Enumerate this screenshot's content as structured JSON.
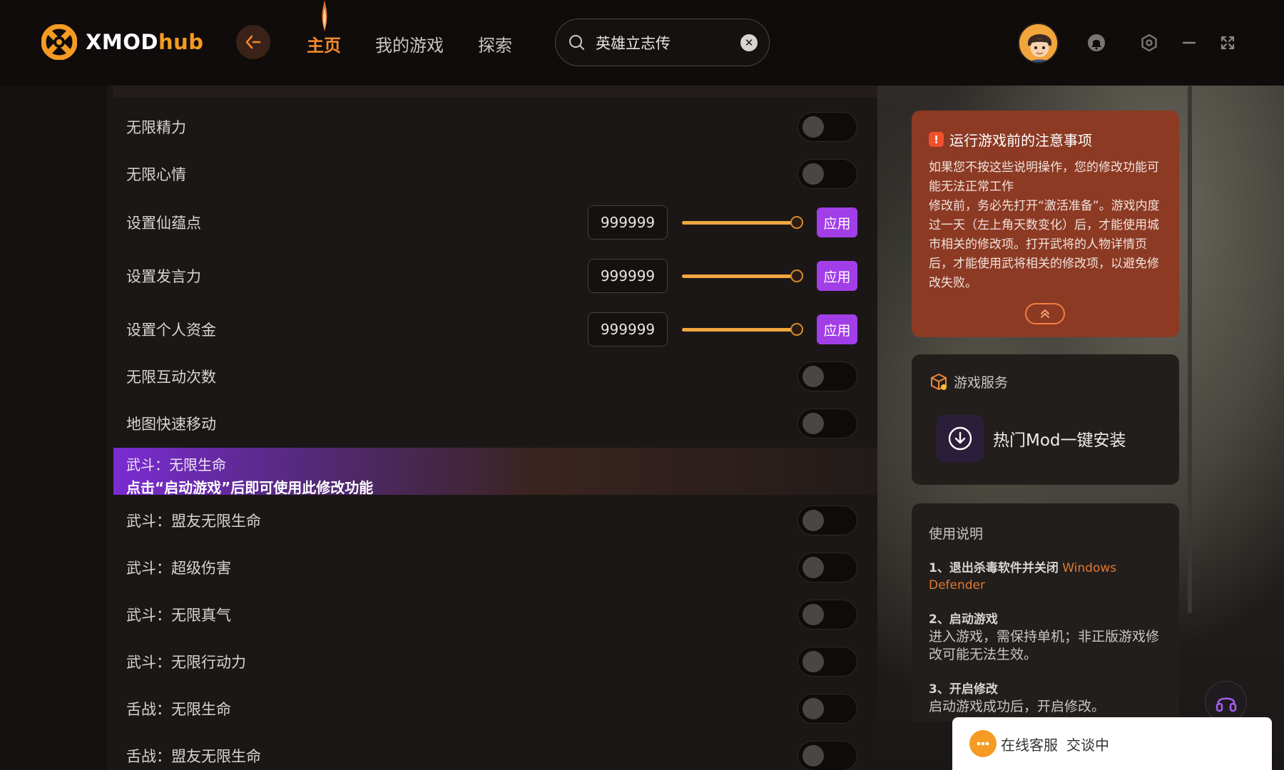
{
  "app": {
    "brand_main": "XMOD",
    "brand_accent": "hub"
  },
  "nav": {
    "items": [
      "主页",
      "我的游戏",
      "探索"
    ],
    "active": 0
  },
  "search": {
    "value": "英雄立志传",
    "clear_icon": "✕"
  },
  "options_top": [
    {
      "label": "无限精力",
      "on": false
    },
    {
      "label": "无限心情",
      "on": false
    }
  ],
  "sliders": [
    {
      "label": "设置仙蕴点",
      "value": "999999",
      "apply": "应用",
      "level": 1.0
    },
    {
      "label": "设置发言力",
      "value": "999999",
      "apply": "应用",
      "level": 1.0
    },
    {
      "label": "设置个人资金",
      "value": "999999",
      "apply": "应用",
      "level": 1.0
    }
  ],
  "options_mid": [
    {
      "label": "无限互动次数",
      "on": false
    },
    {
      "label": "地图快速移动",
      "on": false
    }
  ],
  "highlight": {
    "title": "武斗：无限生命",
    "note": "点击“启动游戏”后即可使用此修改功能"
  },
  "options_bottom": [
    {
      "label": "武斗：盟友无限生命",
      "on": false
    },
    {
      "label": "武斗：超级伤害",
      "on": false
    },
    {
      "label": "武斗：无限真气",
      "on": false
    },
    {
      "label": "武斗：无限行动力",
      "on": false
    },
    {
      "label": "舌战：无限生命",
      "on": false
    },
    {
      "label": "舌战：盟友无限生命",
      "on": false
    }
  ],
  "notice": {
    "title": "运行游戏前的注意事项",
    "line1": "如果您不按这些说明操作，您的修改功能可能无法正常工作",
    "line2": "修改前，务必先打开“激活准备”。游戏内度过一天（左上角天数变化）后，才能使用城市相关的修改项。打开武将的人物详情页后，才能使用武将相关的修改项，以避免修改失败。"
  },
  "service": {
    "title": "游戏服务",
    "item": "热门Mod一键安装"
  },
  "guide": {
    "title": "使用说明",
    "step1": "1、退出杀毒软件并关闭",
    "step1_hl": "Windows Defender",
    "step2": "2、启动游戏",
    "step2_desc": "进入游戏，需保持单机；非正版游戏修改可能无法生效。",
    "step3": "3、开启修改",
    "step3_desc": "启动游戏成功后，开启修改。"
  },
  "chat": {
    "label": "在线客服",
    "status": "交谈中"
  },
  "colors": {
    "accent": "#f58a2b",
    "apply": "#a23ee8",
    "notice": "#8c3a24",
    "slider": "#f2a640"
  }
}
